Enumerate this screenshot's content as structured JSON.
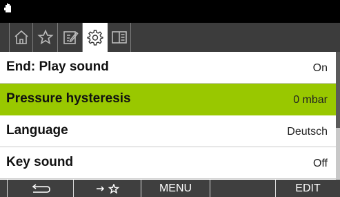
{
  "colors": {
    "status_bar": "#000000",
    "tab_bar": "#3c3c3c",
    "selected_row": "#99c800",
    "softkey_bar": "#3f3f3f"
  },
  "status": {
    "icon": "hand-icon"
  },
  "tabs": [
    {
      "icon": "home-icon",
      "active": false
    },
    {
      "icon": "star-icon",
      "active": false
    },
    {
      "icon": "edit-icon",
      "active": false
    },
    {
      "icon": "gear-icon",
      "active": true
    },
    {
      "icon": "book-icon",
      "active": false
    }
  ],
  "settings": [
    {
      "label": "End: Play sound",
      "value": "On",
      "selected": false
    },
    {
      "label": "Pressure hysteresis",
      "value": "0 mbar",
      "selected": true
    },
    {
      "label": "Language",
      "value": "Deutsch",
      "selected": false
    },
    {
      "label": "Key sound",
      "value": "Off",
      "selected": false
    }
  ],
  "softkeys": {
    "back_icon": "back-arrow-icon",
    "favorite_icon": "arrow-star-icon",
    "menu": "MENU",
    "empty": "",
    "edit": "EDIT"
  }
}
